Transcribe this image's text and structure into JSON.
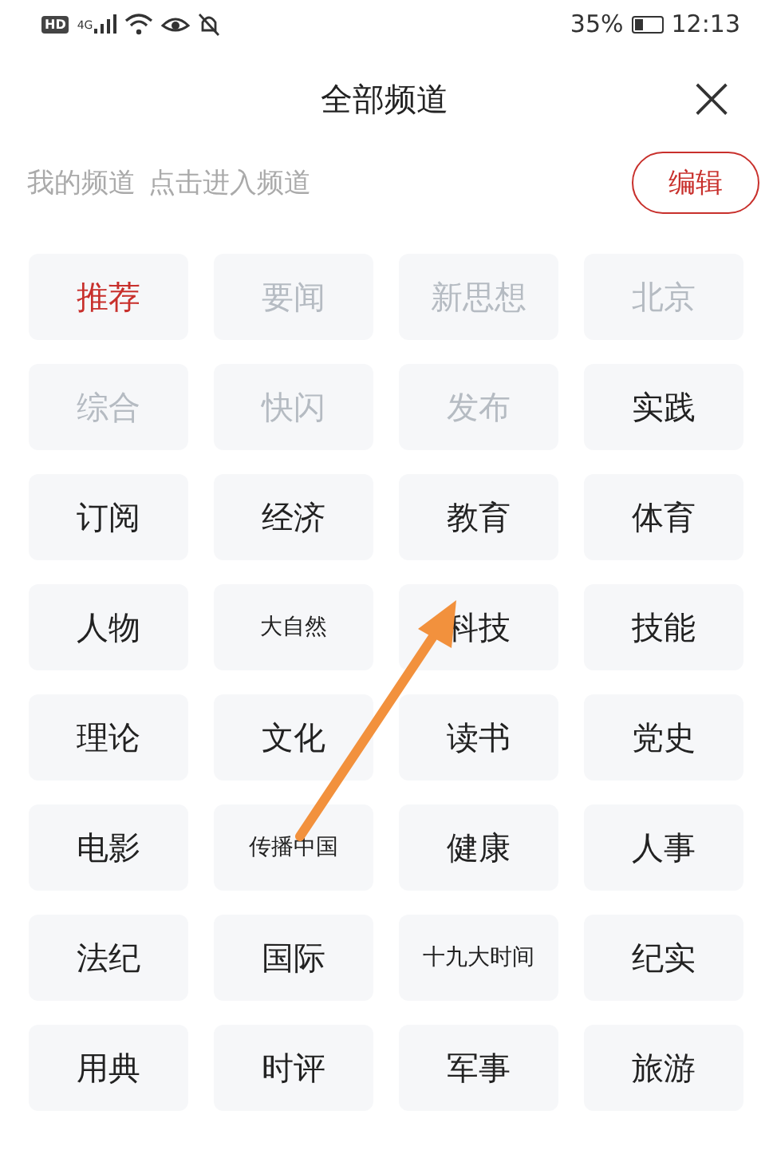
{
  "status_bar": {
    "badges": [
      "HD",
      "4G"
    ],
    "battery_percent": "35%",
    "time": "12:13"
  },
  "header": {
    "title": "全部频道",
    "close": "×"
  },
  "my_channels": {
    "title": "我的频道",
    "hint": "点击进入频道",
    "edit_button": "编辑"
  },
  "channels": [
    {
      "label": "推荐",
      "selected": true,
      "compact": false
    },
    {
      "label": "要闻",
      "selected": false,
      "fixed": true,
      "compact": false
    },
    {
      "label": "新思想",
      "selected": false,
      "fixed": true,
      "compact": false
    },
    {
      "label": "北京",
      "selected": false,
      "fixed": true,
      "compact": false
    },
    {
      "label": "综合",
      "selected": false,
      "fixed": true,
      "compact": false
    },
    {
      "label": "快闪",
      "selected": false,
      "fixed": true,
      "compact": false
    },
    {
      "label": "发布",
      "selected": false,
      "fixed": true,
      "compact": false
    },
    {
      "label": "实践",
      "selected": false,
      "fixed": false,
      "compact": false
    },
    {
      "label": "订阅",
      "selected": false,
      "fixed": false,
      "compact": false
    },
    {
      "label": "经济",
      "selected": false,
      "fixed": false,
      "compact": false
    },
    {
      "label": "教育",
      "selected": false,
      "fixed": false,
      "compact": false
    },
    {
      "label": "体育",
      "selected": false,
      "fixed": false,
      "compact": false
    },
    {
      "label": "人物",
      "selected": false,
      "fixed": false,
      "compact": false
    },
    {
      "label": "大自然",
      "selected": false,
      "fixed": false,
      "compact": true
    },
    {
      "label": "科技",
      "selected": false,
      "fixed": false,
      "compact": false
    },
    {
      "label": "技能",
      "selected": false,
      "fixed": false,
      "compact": false
    },
    {
      "label": "理论",
      "selected": false,
      "fixed": false,
      "compact": false
    },
    {
      "label": "文化",
      "selected": false,
      "fixed": false,
      "compact": false
    },
    {
      "label": "读书",
      "selected": false,
      "fixed": false,
      "compact": false
    },
    {
      "label": "党史",
      "selected": false,
      "fixed": false,
      "compact": false
    },
    {
      "label": "电影",
      "selected": false,
      "fixed": false,
      "compact": false
    },
    {
      "label": "传播中国",
      "selected": false,
      "fixed": false,
      "compact": true
    },
    {
      "label": "健康",
      "selected": false,
      "fixed": false,
      "compact": false
    },
    {
      "label": "人事",
      "selected": false,
      "fixed": false,
      "compact": false
    },
    {
      "label": "法纪",
      "selected": false,
      "fixed": false,
      "compact": false
    },
    {
      "label": "国际",
      "selected": false,
      "fixed": false,
      "compact": false
    },
    {
      "label": "十九大时间",
      "selected": false,
      "fixed": false,
      "compact": true
    },
    {
      "label": "纪实",
      "selected": false,
      "fixed": false,
      "compact": false
    },
    {
      "label": "用典",
      "selected": false,
      "fixed": false,
      "compact": false
    },
    {
      "label": "时评",
      "selected": false,
      "fixed": false,
      "compact": false
    },
    {
      "label": "军事",
      "selected": false,
      "fixed": false,
      "compact": false
    },
    {
      "label": "旅游",
      "selected": false,
      "fixed": false,
      "compact": false
    }
  ],
  "annotations": [
    {
      "kind": "arrow"
    }
  ]
}
